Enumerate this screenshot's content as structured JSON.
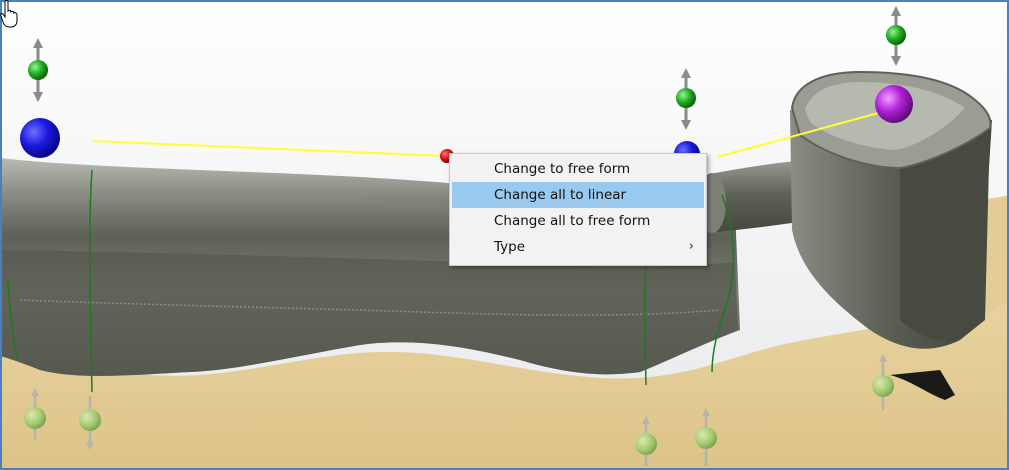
{
  "context_menu": {
    "items": [
      {
        "label": "Change to free form",
        "highlighted": false,
        "has_submenu": false
      },
      {
        "label": "Change all to linear",
        "highlighted": true,
        "has_submenu": false
      },
      {
        "label": "Change all to free form",
        "highlighted": false,
        "has_submenu": false
      },
      {
        "label": "Type",
        "highlighted": false,
        "has_submenu": true
      }
    ],
    "submenu_arrow": "›",
    "highlight_color": "#99c9ef"
  },
  "scene": {
    "description_icons": [
      "blue-control-point-icon",
      "red-control-point-icon",
      "magenta-control-point-icon",
      "green-handle-icon"
    ],
    "colors": {
      "model": "#6b6e62",
      "gum": "#e5cf9e",
      "spline": "#ffff33",
      "control_point_blue": "#1a1adf",
      "control_point_red": "#dd1111",
      "control_point_magenta": "#b020d8",
      "handle_green": "#22b022",
      "border": "#4a7fc1"
    }
  }
}
